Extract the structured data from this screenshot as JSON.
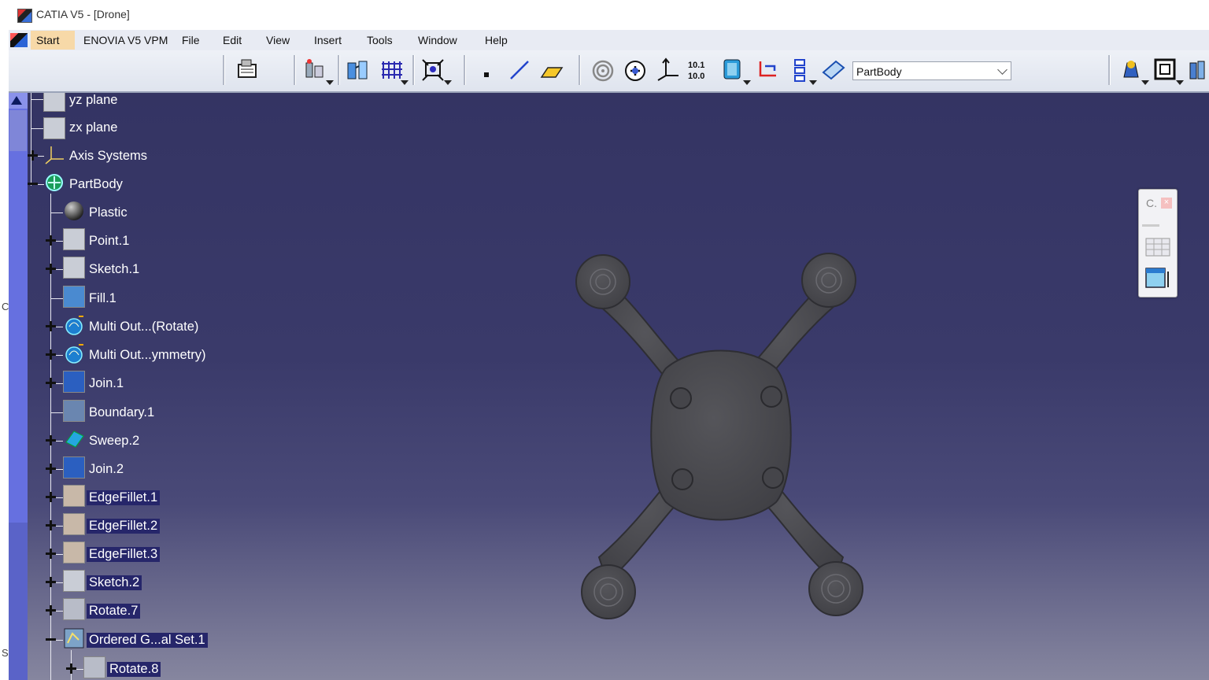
{
  "window": {
    "title": "CATIA V5 - [Drone]"
  },
  "edge_fragments": [
    "C",
    "S"
  ],
  "menu": {
    "items": [
      "Start",
      "ENOVIA V5 VPM",
      "File",
      "Edit",
      "View",
      "Insert",
      "Tools",
      "Window",
      "Help"
    ]
  },
  "toolbar": {
    "body_selector": "PartBody",
    "icons": [
      "snapshot-icon",
      "analysis-icon",
      "compass-icon",
      "grid-icon",
      "fit-all-icon",
      "point-icon",
      "line-icon",
      "plane-icon",
      "spiral-icon",
      "pan-icon",
      "axis-system-icon",
      "measure-icon",
      "datum-icon",
      "swap-icon",
      "stack-icon",
      "work-object-icon",
      "apply-material-icon",
      "view-icon",
      "render-icon"
    ]
  },
  "tree": {
    "items": [
      {
        "label": "yz plane",
        "icon": "plane-icon"
      },
      {
        "label": "zx plane",
        "icon": "plane-icon"
      },
      {
        "label": "Axis Systems",
        "icon": "axis-system-icon"
      },
      {
        "label": "PartBody",
        "icon": "partbody-icon"
      },
      {
        "label": "Plastic",
        "icon": "material-sphere-icon"
      },
      {
        "label": "Point.1",
        "icon": "point-icon"
      },
      {
        "label": "Sketch.1",
        "icon": "sketch-icon"
      },
      {
        "label": "Fill.1",
        "icon": "fill-icon"
      },
      {
        "label": "Multi Out...(Rotate)",
        "icon": "multi-output-icon"
      },
      {
        "label": "Multi Out...ymmetry)",
        "icon": "multi-output-icon"
      },
      {
        "label": "Join.1",
        "icon": "join-icon"
      },
      {
        "label": "Boundary.1",
        "icon": "boundary-icon"
      },
      {
        "label": "Sweep.2",
        "icon": "sweep-icon"
      },
      {
        "label": "Join.2",
        "icon": "join-icon"
      },
      {
        "label": "EdgeFillet.1",
        "icon": "edge-fillet-icon"
      },
      {
        "label": "EdgeFillet.2",
        "icon": "edge-fillet-icon"
      },
      {
        "label": "EdgeFillet.3",
        "icon": "edge-fillet-icon"
      },
      {
        "label": "Sketch.2",
        "icon": "sketch-icon"
      },
      {
        "label": "Rotate.7",
        "icon": "rotate-icon"
      },
      {
        "label": "Ordered G...al Set.1",
        "icon": "ordered-geometrical-set-icon"
      },
      {
        "label": "Rotate.8",
        "icon": "rotate-icon"
      }
    ]
  },
  "compass_panel": {
    "title": "C.",
    "close": "×"
  },
  "colors": {
    "viewport_top": "#343463",
    "viewport_bottom": "#86869f",
    "model": "#4a4a4d",
    "scrollbar": "#6670e0",
    "start_highlight": "#f7d9a8"
  }
}
